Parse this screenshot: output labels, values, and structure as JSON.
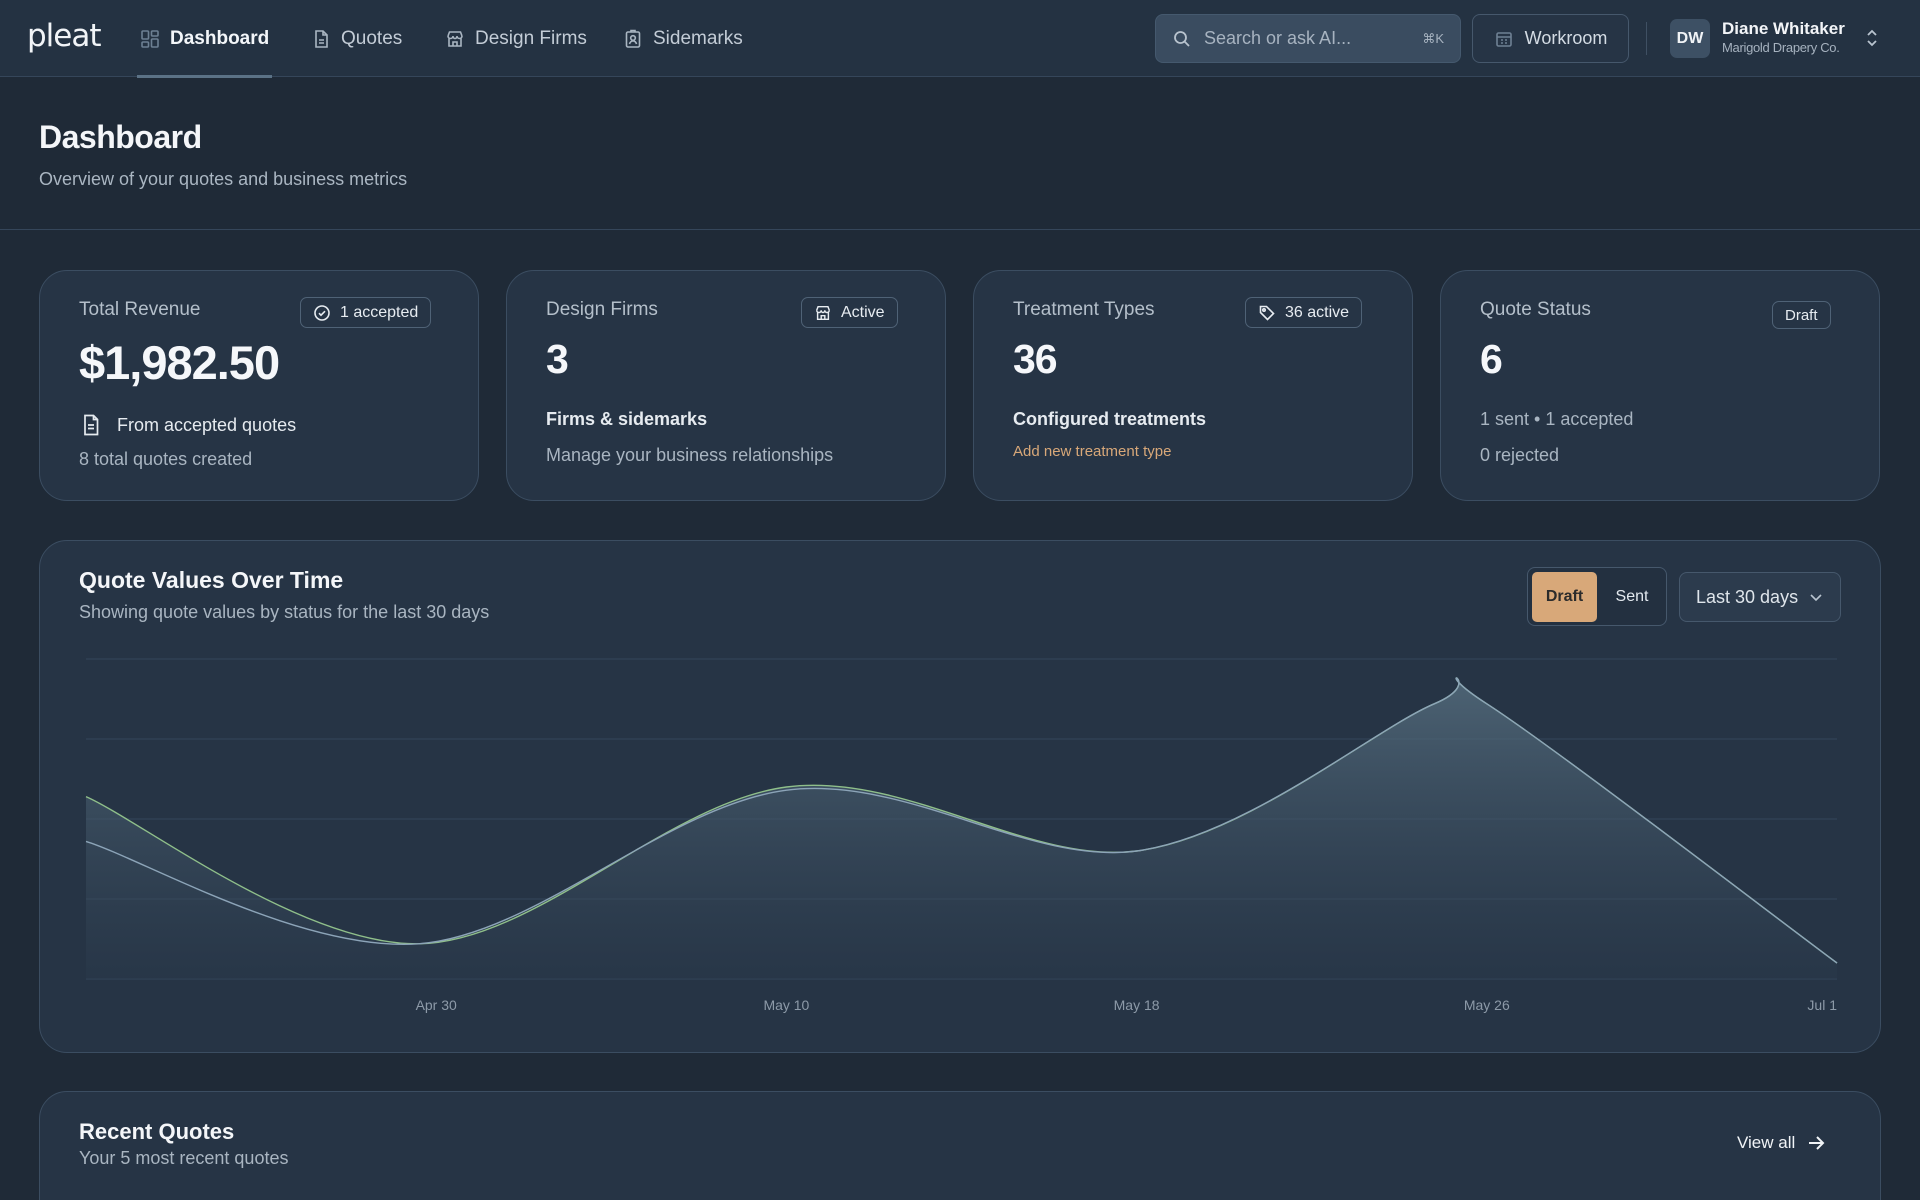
{
  "app": {
    "logo": "pleat"
  },
  "nav": {
    "items": [
      {
        "label": "Dashboard",
        "icon": "grid-icon",
        "active": true
      },
      {
        "label": "Quotes",
        "icon": "document-icon",
        "active": false
      },
      {
        "label": "Design Firms",
        "icon": "storefront-icon",
        "active": false
      },
      {
        "label": "Sidemarks",
        "icon": "badge-icon",
        "active": false
      }
    ],
    "search_placeholder": "Search or ask AI...",
    "search_shortcut": "⌘K",
    "workroom_label": "Workroom",
    "user": {
      "initials": "DW",
      "name": "Diane Whitaker",
      "org": "Marigold Drapery Co."
    }
  },
  "page": {
    "title": "Dashboard",
    "subtitle": "Overview of your quotes and business metrics"
  },
  "cards": {
    "revenue": {
      "label": "Total Revenue",
      "badge": "1 accepted",
      "value": "$1,982.50",
      "line1": "From accepted quotes",
      "line2": "8 total quotes created"
    },
    "firms": {
      "label": "Design Firms",
      "badge": "Active",
      "value": "3",
      "line1": "Firms & sidemarks",
      "line2": "Manage your business relationships"
    },
    "treatments": {
      "label": "Treatment Types",
      "badge": "36 active",
      "value": "36",
      "line1": "Configured treatments",
      "link": "Add new treatment type"
    },
    "status": {
      "label": "Quote Status",
      "badge": "Draft",
      "value": "6",
      "line1": "1 sent • 1 accepted",
      "line2": "0 rejected"
    }
  },
  "chart_section": {
    "title": "Quote Values Over Time",
    "subtitle": "Showing quote values by status for the last 30 days",
    "toggle": {
      "active": "Draft",
      "inactive": "Sent"
    },
    "range": "Last 30 days"
  },
  "chart_data": {
    "type": "area",
    "x_ticks": [
      "Apr 30",
      "May 10",
      "May 18",
      "May 26",
      "Jul 1"
    ],
    "x_positions": [
      0.0,
      0.19,
      0.4,
      0.6,
      0.77,
      0.8,
      1.0
    ],
    "y_range": [
      0,
      100
    ],
    "series": [
      {
        "values": [
          57,
          11,
          60,
          40,
          86,
          86,
          5
        ],
        "color": "#8fbf8a"
      },
      {
        "values": [
          43,
          11,
          59,
          40,
          86,
          86,
          5
        ],
        "color": "#8ca4b8"
      }
    ],
    "grid": true
  },
  "recent": {
    "title": "Recent Quotes",
    "subtitle": "Your 5 most recent quotes",
    "view_all": "View all"
  },
  "colors": {
    "background": "#1f2a37",
    "card": "#263445",
    "accent": "#d8a879",
    "line": "#8fbf8a"
  }
}
